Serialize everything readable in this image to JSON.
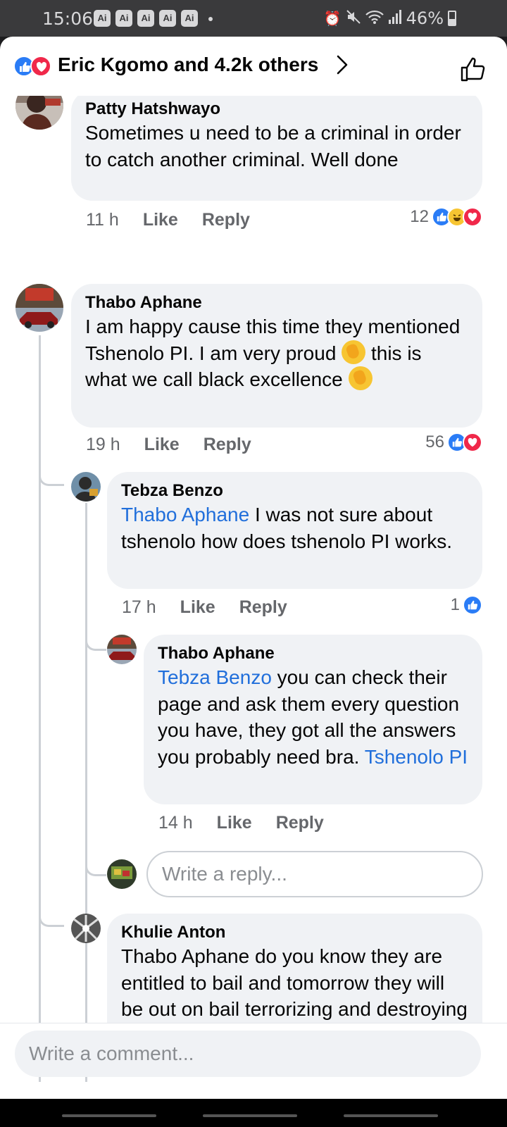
{
  "status_bar": {
    "time": "15:06",
    "badges": [
      "Ai",
      "Ai",
      "Ai",
      "Ai",
      "Ai"
    ],
    "battery": "46%"
  },
  "header": {
    "title": "Eric Kgomo and 4.2k others"
  },
  "comments": [
    {
      "author": "Patty Hatshwayo",
      "text": "Sometimes u need to be a criminal in order to catch another criminal.  Well done",
      "time": "11 h",
      "like": "Like",
      "reply": "Reply",
      "reaction_count": "12"
    },
    {
      "author": "Thabo Aphane",
      "text_1": "I am happy cause this time they mentioned Tshenolo PI. I am very proud",
      "text_2": " this is what we call black excellence",
      "time": "19 h",
      "like": "Like",
      "reply": "Reply",
      "reaction_count": "56"
    },
    {
      "author": "Tebza Benzo",
      "mention": "Thabo Aphane",
      "text": " I was not sure about tshenolo how does tshenolo PI works.",
      "time": "17 h",
      "like": "Like",
      "reply": "Reply",
      "reaction_count": "1"
    },
    {
      "author": "Thabo Aphane",
      "mention": "Tebza Benzo",
      "text": " you can check their page and ask them every question you have, they got all the answers you probably need bra. ",
      "mention_2": "Tshenolo PI",
      "time": "14 h",
      "like": "Like",
      "reply": "Reply"
    },
    {
      "author": "Khulie Anton",
      "text": "Thabo Aphane do you know they are entitled to bail and tomorrow they will be out on bail terrorizing and destroying innocent souls"
    }
  ],
  "reply_input": {
    "placeholder": "Write a reply..."
  },
  "comment_input": {
    "placeholder": "Write a comment..."
  },
  "colors": {
    "like_blue": "#2a7cf6",
    "love_red": "#f0284a",
    "mention_blue": "#216fdb",
    "bubble_gray": "#f0f2f5"
  },
  "icons": [
    "like-reaction-icon",
    "love-reaction-icon",
    "haha-reaction-icon",
    "chevron-right-icon",
    "thumbs-up-icon",
    "clap-emoji-icon"
  ]
}
